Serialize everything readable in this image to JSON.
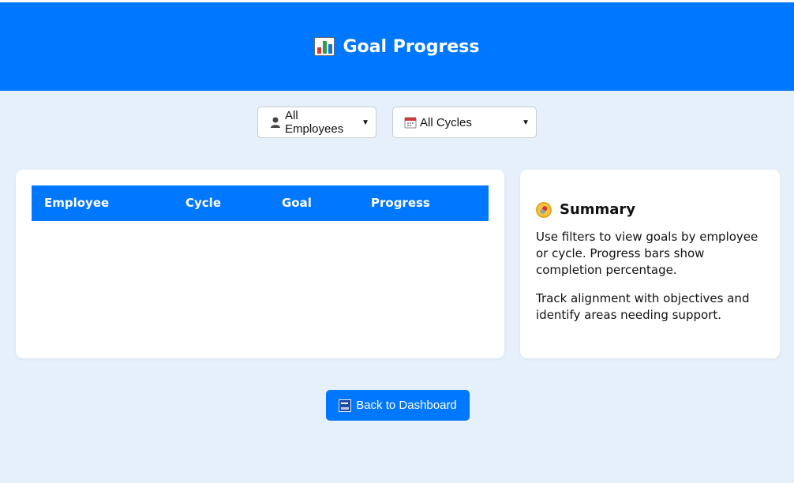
{
  "header": {
    "title": "Goal Progress",
    "icon": "bar-chart-icon"
  },
  "filters": {
    "employee": {
      "selected": "All Employees",
      "icon": "person-icon"
    },
    "cycle": {
      "selected": "All Cycles",
      "icon": "calendar-icon"
    }
  },
  "table": {
    "columns": [
      "Employee",
      "Cycle",
      "Goal",
      "Progress"
    ],
    "rows": []
  },
  "summary": {
    "title": "Summary",
    "icon": "compass-icon",
    "paragraphs": [
      "Use filters to view goals by employee or cycle. Progress bars show completion percentage.",
      "Track alignment with objectives and identify areas needing support."
    ]
  },
  "actions": {
    "back_label": "Back to Dashboard",
    "back_icon": "back-icon"
  },
  "colors": {
    "accent": "#0077ff",
    "background": "#e6f0fa",
    "card": "#ffffff"
  }
}
